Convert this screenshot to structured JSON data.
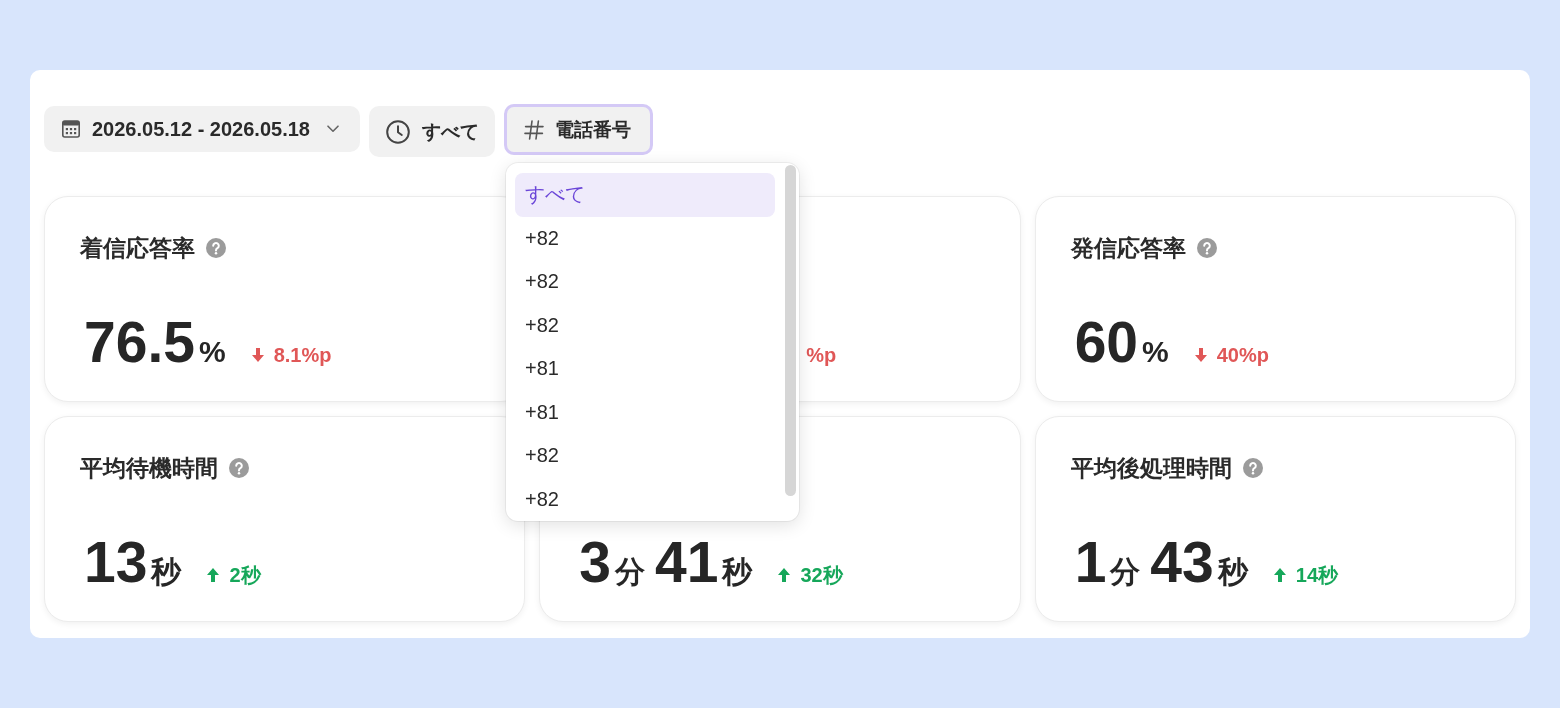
{
  "filters": [
    {
      "kind": "date",
      "label": "2026.05.12 - 2026.05.18",
      "open": false
    },
    {
      "kind": "time",
      "label": "すべて",
      "open": false
    },
    {
      "kind": "phone",
      "label": "電話番号",
      "open": true
    }
  ],
  "dropdown": {
    "options": [
      {
        "label": "すべて",
        "selected": true
      },
      {
        "label": "+82",
        "selected": false
      },
      {
        "label": "+82",
        "selected": false
      },
      {
        "label": "+82",
        "selected": false
      },
      {
        "label": "+81",
        "selected": false
      },
      {
        "label": "+81",
        "selected": false
      },
      {
        "label": "+82",
        "selected": false
      },
      {
        "label": "+82",
        "selected": false
      }
    ]
  },
  "cards": [
    {
      "title": "着信応答率",
      "value": [
        {
          "number": "76.5",
          "unit": "%"
        }
      ],
      "change": {
        "increase": false,
        "arrow": true,
        "text": "8.1%p"
      }
    },
    {
      "change": {
        "increase": false,
        "arrow": false,
        "text": "%p"
      }
    },
    {
      "title": "発信応答率",
      "value": [
        {
          "number": "60",
          "unit": "%"
        }
      ],
      "change": {
        "increase": false,
        "arrow": true,
        "text": "40%p"
      }
    },
    {
      "title": "平均待機時間",
      "value": [
        {
          "number": "13",
          "unit": "秒"
        }
      ],
      "change": {
        "increase": true,
        "arrow": true,
        "text": "2秒"
      }
    },
    {
      "value": [
        {
          "number": "3",
          "unit": "分"
        },
        {
          "number": "41",
          "unit": "秒"
        }
      ],
      "change": {
        "increase": true,
        "arrow": true,
        "text": "32秒"
      }
    },
    {
      "title": "平均後処理時間",
      "value": [
        {
          "number": "1",
          "unit": "分"
        },
        {
          "number": "43",
          "unit": "秒"
        }
      ],
      "change": {
        "increase": true,
        "arrow": true,
        "text": "14秒"
      }
    }
  ]
}
